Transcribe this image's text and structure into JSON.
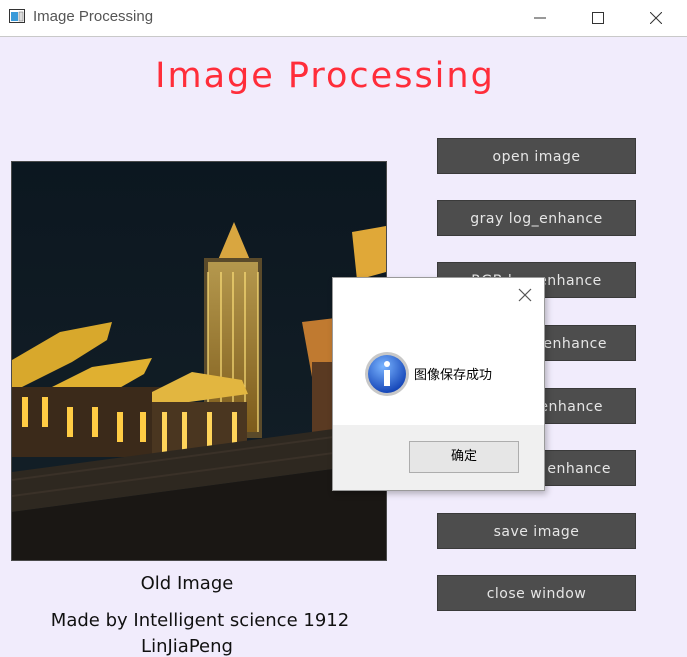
{
  "window": {
    "title": "Image Processing"
  },
  "app": {
    "heading": "Image Processing",
    "heading_color": "#ff2d3a",
    "image_caption": "Old Image",
    "credit_line1": "Made by Intelligent science 1912",
    "credit_line2": "LinJiaPeng"
  },
  "buttons": [
    {
      "label": "open image"
    },
    {
      "label": "gray log_enhance"
    },
    {
      "label": "RGB log_enhance"
    },
    {
      "label": "enhance"
    },
    {
      "label": "enhance"
    },
    {
      "label": "enhance"
    },
    {
      "label": "save image"
    },
    {
      "label": "close window"
    }
  ],
  "dialog": {
    "message": "图像保存成功",
    "ok_label": "确定",
    "icon": "info-icon"
  },
  "colors": {
    "background": "#f1ecfc",
    "button_bg": "#4d4d4d",
    "button_text": "#e6e6e6"
  }
}
